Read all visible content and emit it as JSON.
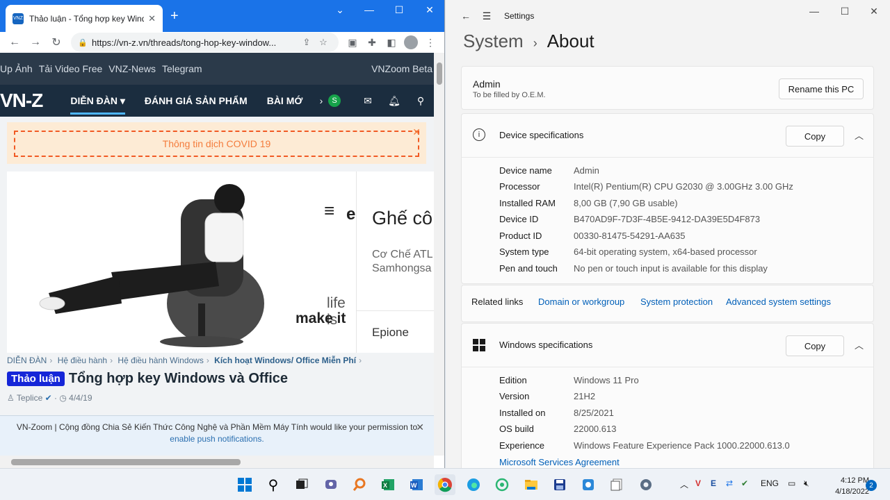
{
  "browser": {
    "tab_title": "Thảo luận - Tổng hợp key Windo",
    "url": "https://vn-z.vn/threads/tong-hop-key-window...",
    "site": {
      "top_links": [
        "Up Ảnh",
        "Tải Video Free",
        "VNZ-News",
        "Telegram"
      ],
      "top_right": "VNZoom Beta",
      "logo": "VN-Z",
      "nav": [
        "DIỄN ĐÀN",
        "ĐÁNH GIÁ SẢN PHẨM",
        "BÀI MỚ"
      ],
      "user_initial": "S",
      "covid": "Thông tin dịch COVID 19",
      "banner": {
        "brand": "e",
        "headline": "Ghế cô",
        "sub1": "Cơ Chế ATL",
        "sub2": "Samhongsa",
        "tag1": "life is",
        "tag2": "make it",
        "product": "Epione"
      },
      "breadcrumbs": [
        "DIỄN ĐÀN",
        "Hệ điều hành",
        "Hệ điều hành Windows",
        "Kích hoạt Windows/ Office Miễn Phí"
      ],
      "thread_badge": "Thảo luận",
      "thread_title": "Tổng hợp key Windows và Office",
      "author": "Teplice",
      "date": "4/4/19",
      "push_text": "VN-Zoom | Cộng đồng Chia Sẻ Kiến Thức Công Nghệ và Phần Mềm Máy Tính would like your permission to",
      "push_link": "enable push notifications."
    }
  },
  "settings": {
    "window_title": "Settings",
    "breadcrumb_parent": "System",
    "breadcrumb_current": "About",
    "pc_name": "Admin",
    "pc_sub": "To be filled by O.E.M.",
    "rename_label": "Rename this PC",
    "device_specs_title": "Device specifications",
    "copy_label": "Copy",
    "device_specs": [
      {
        "k": "Device name",
        "v": "Admin"
      },
      {
        "k": "Processor",
        "v": "Intel(R) Pentium(R) CPU G2030 @ 3.00GHz   3.00 GHz"
      },
      {
        "k": "Installed RAM",
        "v": "8,00 GB (7,90 GB usable)"
      },
      {
        "k": "Device ID",
        "v": "B470AD9F-7D3F-4B5E-9412-DA39E5D4F873"
      },
      {
        "k": "Product ID",
        "v": "00330-81475-54291-AA635"
      },
      {
        "k": "System type",
        "v": "64-bit operating system, x64-based processor"
      },
      {
        "k": "Pen and touch",
        "v": "No pen or touch input is available for this display"
      }
    ],
    "related_links_label": "Related links",
    "related_links": [
      "Domain or workgroup",
      "System protection",
      "Advanced system settings"
    ],
    "windows_specs_title": "Windows specifications",
    "windows_specs": [
      {
        "k": "Edition",
        "v": "Windows 11 Pro"
      },
      {
        "k": "Version",
        "v": "21H2"
      },
      {
        "k": "Installed on",
        "v": "8/25/2021"
      },
      {
        "k": "OS build",
        "v": "22000.613"
      },
      {
        "k": "Experience",
        "v": "Windows Feature Experience Pack 1000.22000.613.0"
      }
    ],
    "msa_link": "Microsoft Services Agreement"
  },
  "taskbar": {
    "lang": "ENG",
    "time": "4:12 PM",
    "date": "4/18/2022",
    "notifications": "2"
  }
}
